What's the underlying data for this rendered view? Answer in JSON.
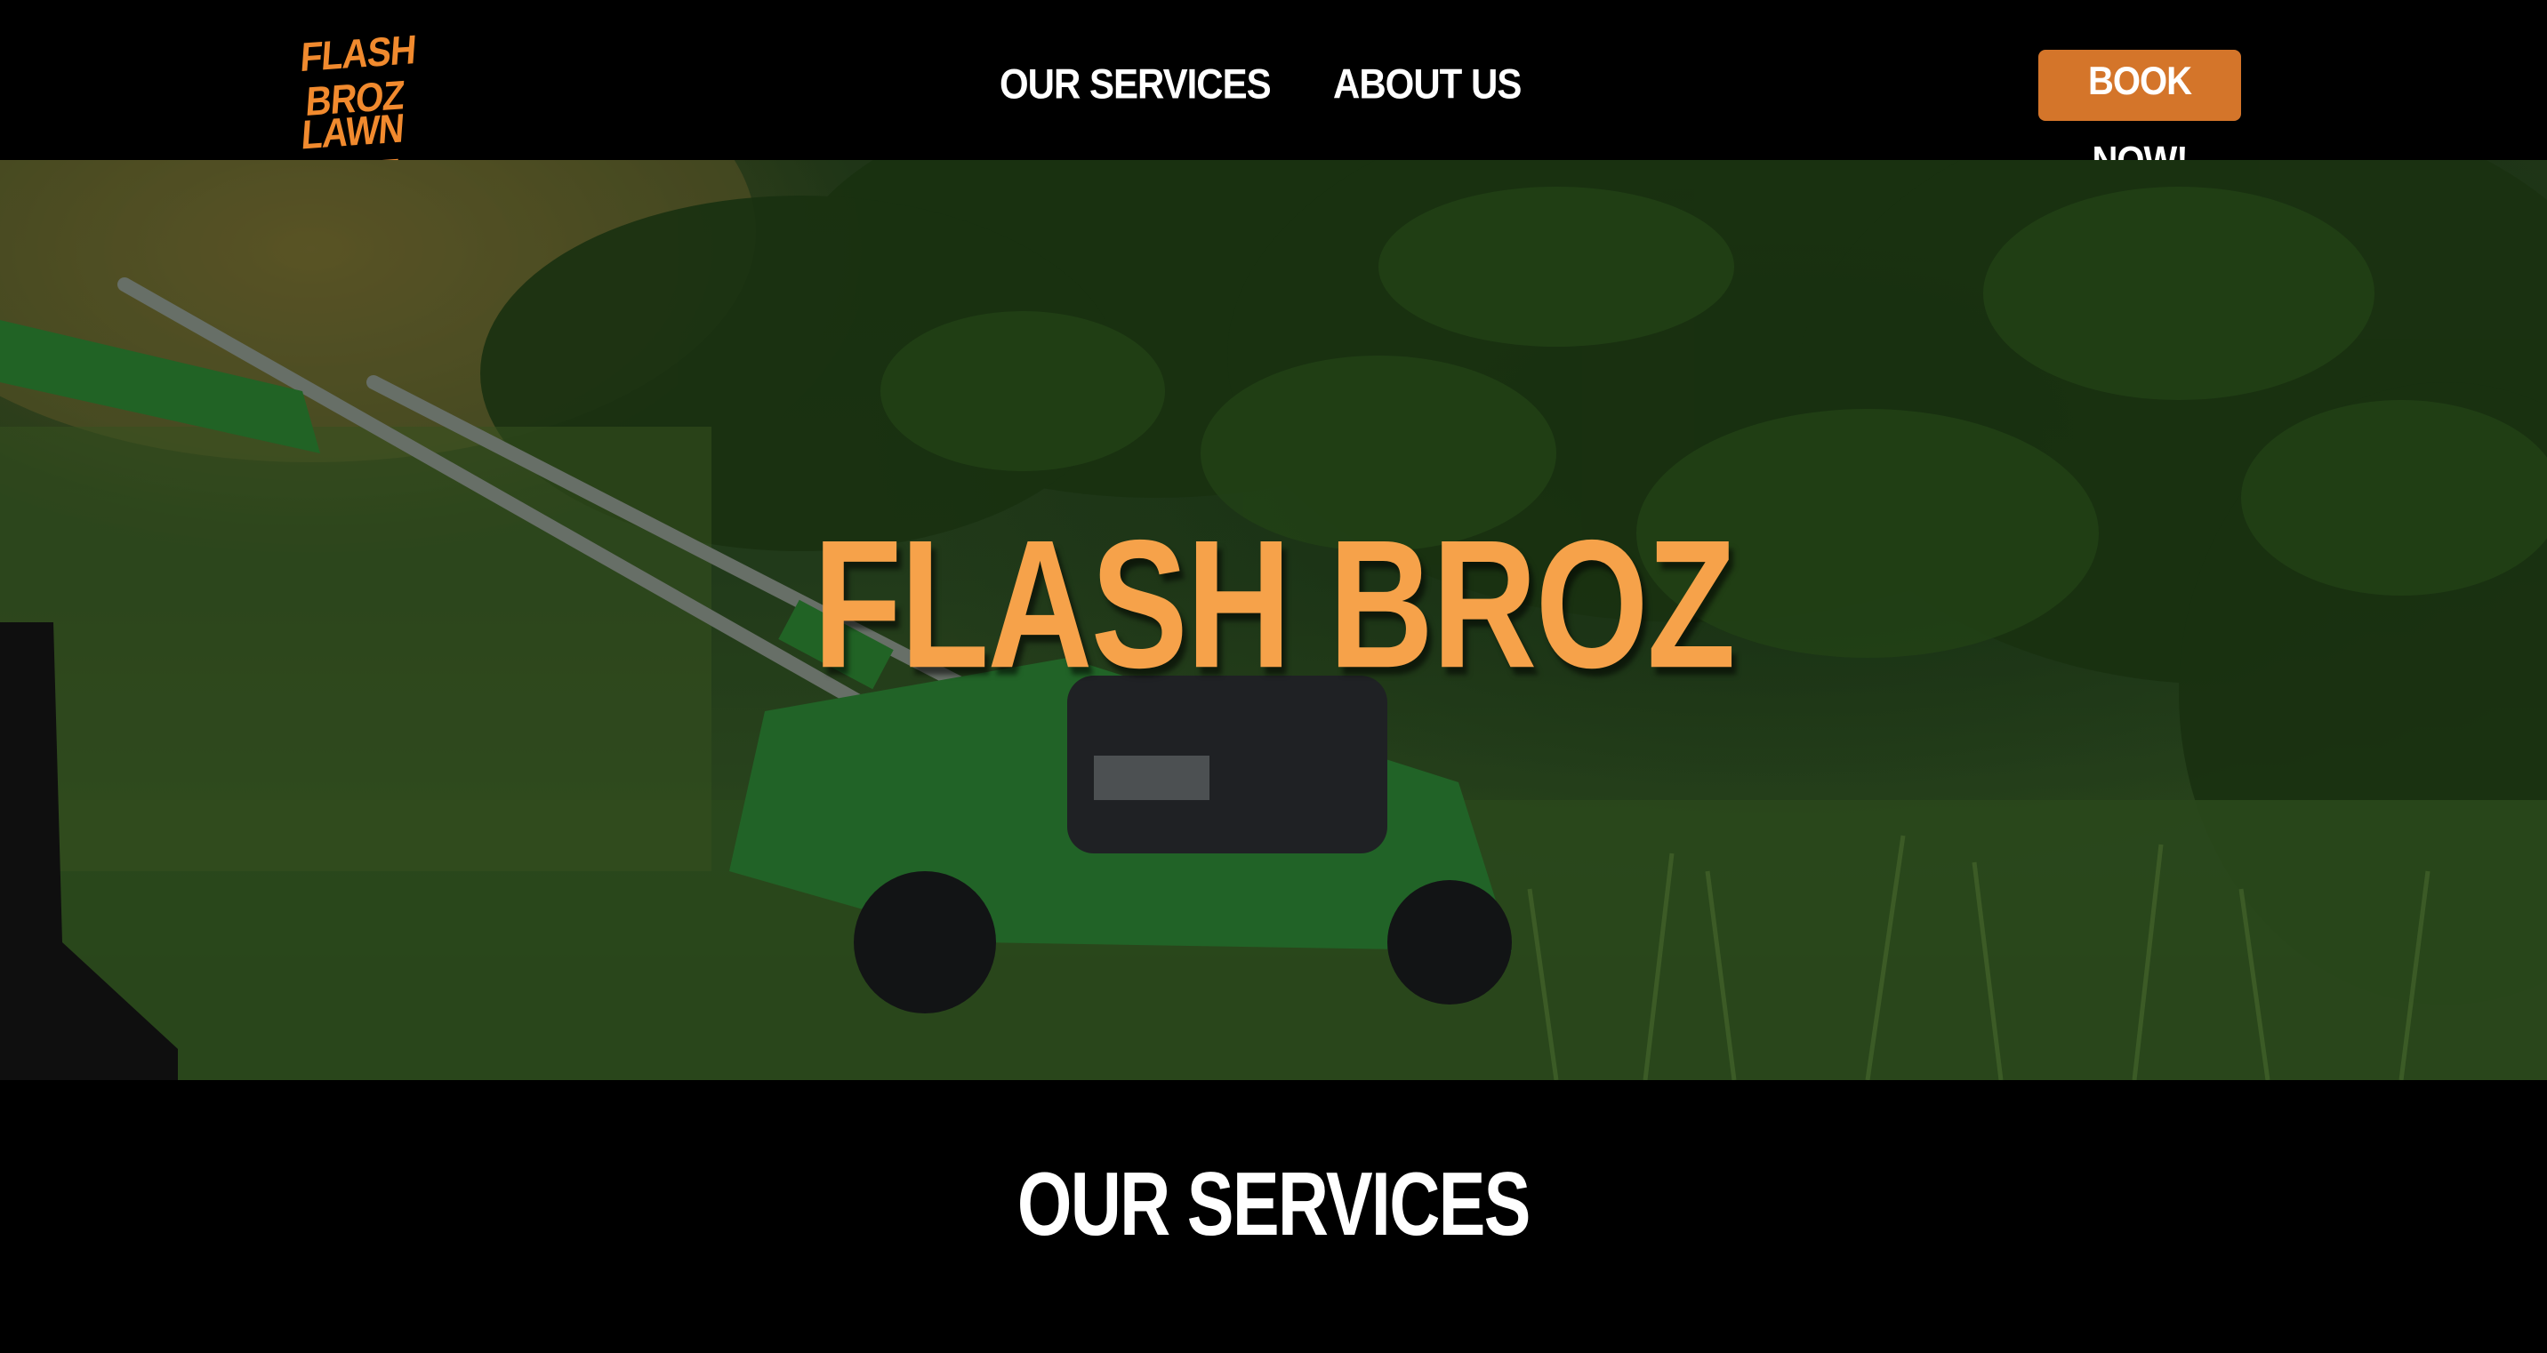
{
  "header": {
    "logo_line1": "FLASH BROZ",
    "logo_line2": "LAWN CARE",
    "nav": [
      {
        "label": "OUR SERVICES"
      },
      {
        "label": "ABOUT US"
      }
    ],
    "cta_label": "BOOK NOW!"
  },
  "hero": {
    "title": "FLASH BROZ",
    "background_image": "lawn-mower-on-grass-photo"
  },
  "services": {
    "title": "OUR SERVICES"
  },
  "colors": {
    "brand_orange": "#f18a2e",
    "button_orange": "#d4752a",
    "hero_title_orange": "#f6a24a",
    "background": "#000000",
    "text": "#ffffff"
  }
}
